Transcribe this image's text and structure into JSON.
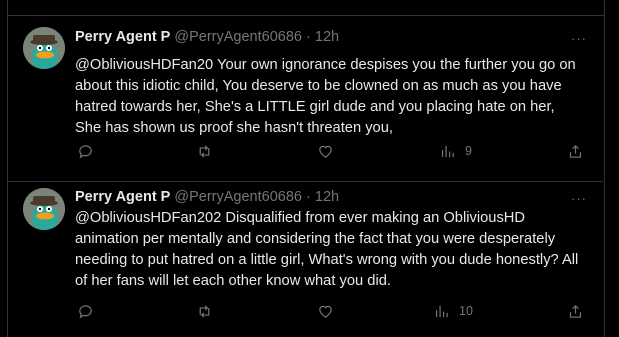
{
  "tweets": [
    {
      "display_name": "Perry Agent P",
      "handle": "@PerryAgent60686",
      "separator": "·",
      "time": "12h",
      "more": "···",
      "text": "@ObliviousHDFan20 Your own ignorance despises you the further you go on\nabout this idiotic child, You deserve to be clowned on as much as you have\nhatred towards her, She's a LITTLE girl dude and you placing hate on her,\nShe has shown us proof she hasn't threaten you,",
      "views": "9"
    },
    {
      "display_name": "Perry Agent P",
      "handle": "@PerryAgent60686",
      "separator": "·",
      "time": "12h",
      "more": "···",
      "text": "@ObliviousHDFan202 Disqualified from ever making an ObliviousHD\nanimation per mentally and considering the fact that you were desperately\nneeding to put hatred on a little girl, What's wrong with you dude honestly? All\nof her fans will let each other know what you did.",
      "views": "10"
    }
  ],
  "colors": {
    "background": "#000000",
    "text": "#e7e9ea",
    "muted": "#71767b",
    "border": "#2f3336",
    "avatar_body": "#2aa99a",
    "avatar_hat": "#4a3a2a",
    "avatar_bill": "#f0a020"
  },
  "icons": [
    "reply-icon",
    "retweet-icon",
    "like-icon",
    "views-icon",
    "share-icon",
    "more-icon"
  ]
}
